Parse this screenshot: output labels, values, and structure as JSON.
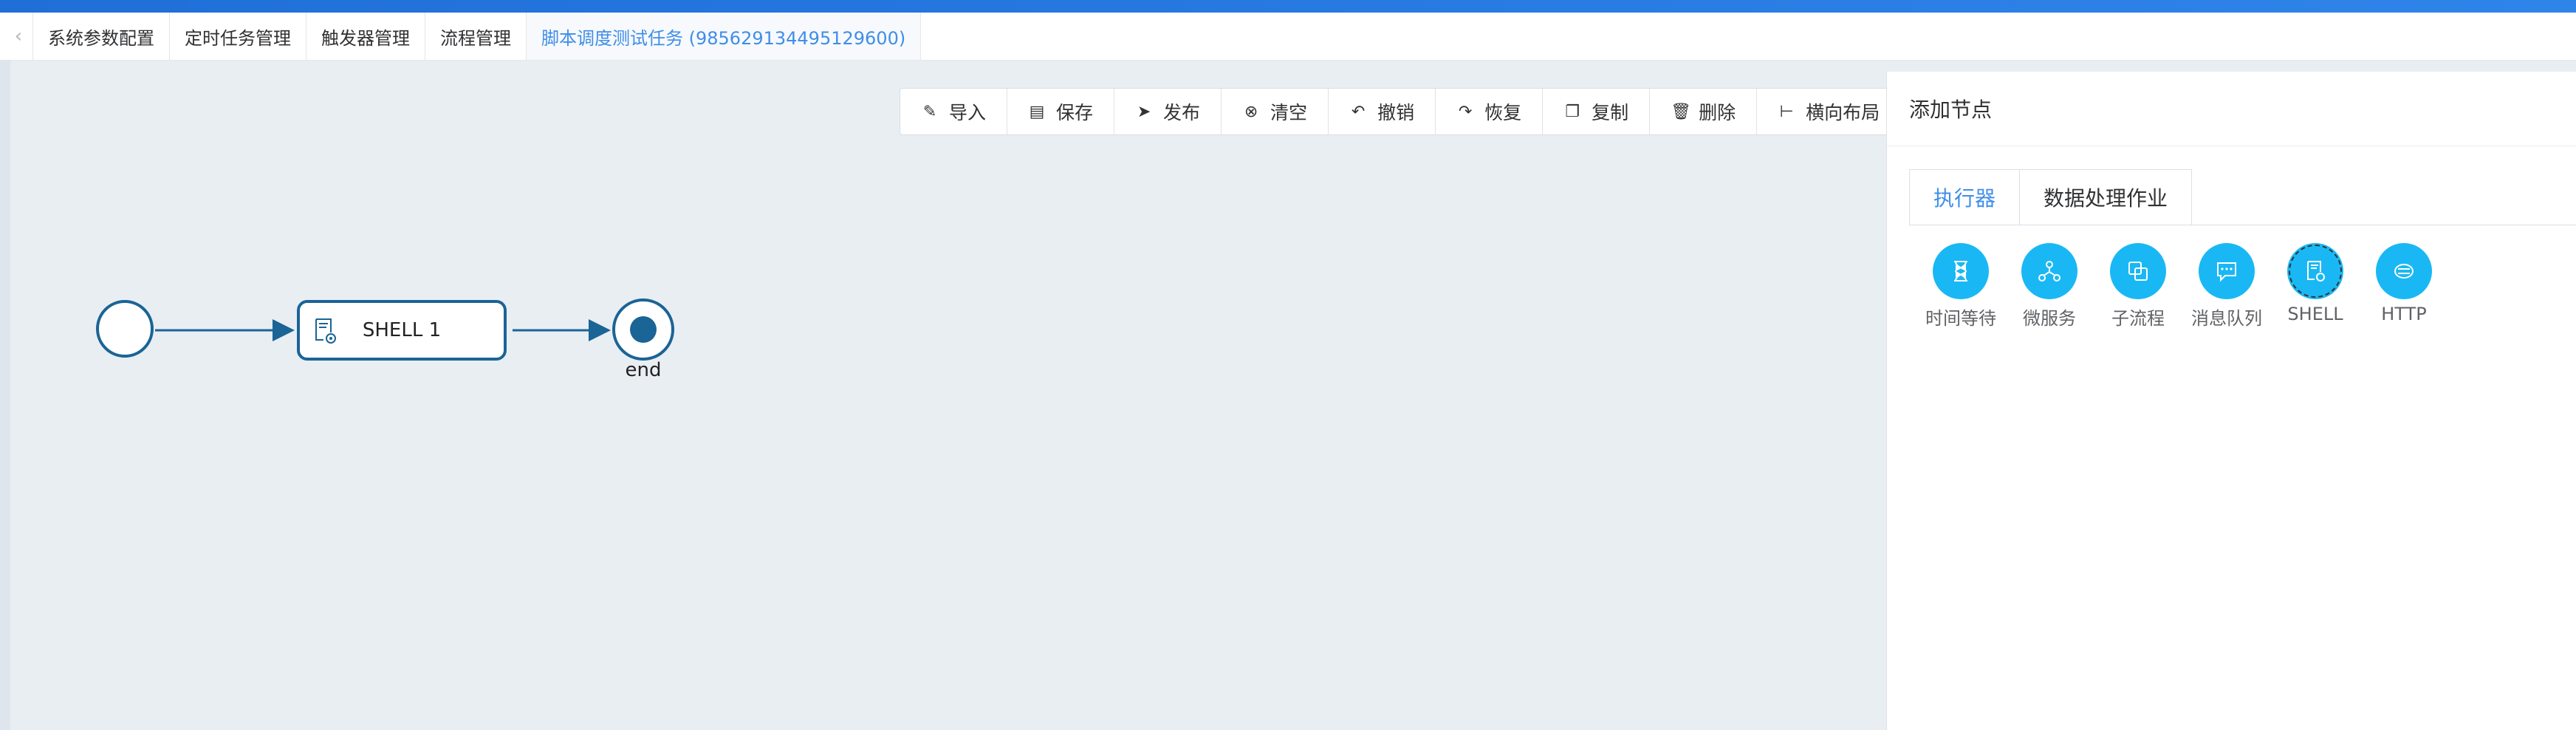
{
  "tabs": [
    {
      "label": "系统参数配置"
    },
    {
      "label": "定时任务管理"
    },
    {
      "label": "触发器管理"
    },
    {
      "label": "流程管理"
    },
    {
      "label": "脚本调度测试任务 (985629134495129600)",
      "active": true
    }
  ],
  "toolbar": {
    "import": "导入",
    "save": "保存",
    "publish": "发布",
    "clear": "清空",
    "undo": "撤销",
    "redo": "恢复",
    "copy": "复制",
    "delete": "删除",
    "layout": "横向布局"
  },
  "flow": {
    "task_label": "SHELL 1",
    "end_label": "end",
    "line_color": "#1a6496"
  },
  "panel": {
    "title": "添加节点",
    "tabs": [
      {
        "label": "执行器",
        "active": true
      },
      {
        "label": "数据处理作业"
      }
    ],
    "nodes": [
      {
        "label": "时间等待",
        "icon": "hourglass-icon"
      },
      {
        "label": "微服务",
        "icon": "microservice-icon"
      },
      {
        "label": "子流程",
        "icon": "subprocess-icon"
      },
      {
        "label": "消息队列",
        "icon": "message-queue-icon"
      },
      {
        "label": "SHELL",
        "icon": "shell-script-icon",
        "selected": true
      },
      {
        "label": "HTTP",
        "icon": "http-icon"
      }
    ],
    "accent": "#19b8f5"
  },
  "colors": {
    "brand": "#2f84ea",
    "active_tab": "#3f8ee8"
  }
}
